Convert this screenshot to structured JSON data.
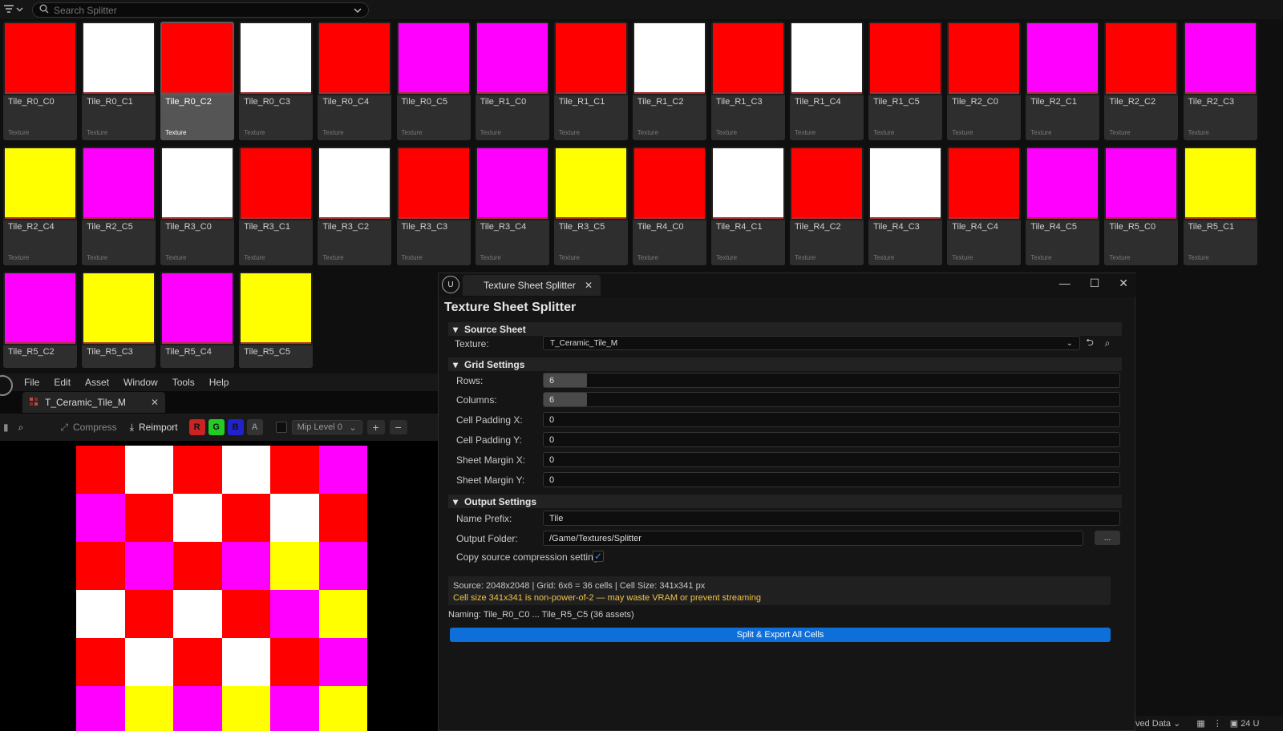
{
  "search": {
    "placeholder": "Search Splitter"
  },
  "colors": {
    "red": "#ff0000",
    "white": "#ffffff",
    "magenta": "#ff00ff",
    "yellow": "#ffff00",
    "accent": "#0e6fd8",
    "warning": "#f0c34a"
  },
  "tiles": [
    {
      "name": "Tile_R0_C0",
      "type": "Texture",
      "color": "red"
    },
    {
      "name": "Tile_R0_C1",
      "type": "Texture",
      "color": "white"
    },
    {
      "name": "Tile_R0_C2",
      "type": "Texture",
      "color": "red",
      "selected": true
    },
    {
      "name": "Tile_R0_C3",
      "type": "Texture",
      "color": "white"
    },
    {
      "name": "Tile_R0_C4",
      "type": "Texture",
      "color": "red"
    },
    {
      "name": "Tile_R0_C5",
      "type": "Texture",
      "color": "magenta"
    },
    {
      "name": "Tile_R1_C0",
      "type": "Texture",
      "color": "magenta"
    },
    {
      "name": "Tile_R1_C1",
      "type": "Texture",
      "color": "red"
    },
    {
      "name": "Tile_R1_C2",
      "type": "Texture",
      "color": "white"
    },
    {
      "name": "Tile_R1_C3",
      "type": "Texture",
      "color": "red"
    },
    {
      "name": "Tile_R1_C4",
      "type": "Texture",
      "color": "white"
    },
    {
      "name": "Tile_R1_C5",
      "type": "Texture",
      "color": "red"
    },
    {
      "name": "Tile_R2_C0",
      "type": "Texture",
      "color": "red"
    },
    {
      "name": "Tile_R2_C1",
      "type": "Texture",
      "color": "magenta"
    },
    {
      "name": "Tile_R2_C2",
      "type": "Texture",
      "color": "red"
    },
    {
      "name": "Tile_R2_C3",
      "type": "Texture",
      "color": "magenta"
    },
    {
      "name": "Tile_R2_C4",
      "type": "Texture",
      "color": "yellow"
    },
    {
      "name": "Tile_R2_C5",
      "type": "Texture",
      "color": "magenta"
    },
    {
      "name": "Tile_R3_C0",
      "type": "Texture",
      "color": "white"
    },
    {
      "name": "Tile_R3_C1",
      "type": "Texture",
      "color": "red"
    },
    {
      "name": "Tile_R3_C2",
      "type": "Texture",
      "color": "white"
    },
    {
      "name": "Tile_R3_C3",
      "type": "Texture",
      "color": "red"
    },
    {
      "name": "Tile_R3_C4",
      "type": "Texture",
      "color": "magenta"
    },
    {
      "name": "Tile_R3_C5",
      "type": "Texture",
      "color": "yellow"
    },
    {
      "name": "Tile_R4_C0",
      "type": "Texture",
      "color": "red"
    },
    {
      "name": "Tile_R4_C1",
      "type": "Texture",
      "color": "white"
    },
    {
      "name": "Tile_R4_C2",
      "type": "Texture",
      "color": "red"
    },
    {
      "name": "Tile_R4_C3",
      "type": "Texture",
      "color": "white"
    },
    {
      "name": "Tile_R4_C4",
      "type": "Texture",
      "color": "red"
    },
    {
      "name": "Tile_R4_C5",
      "type": "Texture",
      "color": "magenta"
    },
    {
      "name": "Tile_R5_C0",
      "type": "Texture",
      "color": "magenta"
    },
    {
      "name": "Tile_R5_C1",
      "type": "Texture",
      "color": "yellow"
    },
    {
      "name": "Tile_R5_C2",
      "type": "Texture",
      "color": "magenta"
    },
    {
      "name": "Tile_R5_C3",
      "type": "Texture",
      "color": "yellow"
    },
    {
      "name": "Tile_R5_C4",
      "type": "Texture",
      "color": "magenta"
    },
    {
      "name": "Tile_R5_C5",
      "type": "Texture",
      "color": "yellow"
    }
  ],
  "editor": {
    "menu": [
      "File",
      "Edit",
      "Asset",
      "Window",
      "Tools",
      "Help"
    ],
    "asset_tab": "T_Ceramic_Tile_M",
    "compress_label": "Compress",
    "reimport_label": "Reimport",
    "channels": [
      "R",
      "G",
      "B",
      "A"
    ],
    "mip_label": "Mip Level 0",
    "sheet_colors": [
      [
        "red",
        "white",
        "red",
        "white",
        "red",
        "magenta"
      ],
      [
        "magenta",
        "red",
        "white",
        "red",
        "white",
        "red"
      ],
      [
        "red",
        "magenta",
        "red",
        "magenta",
        "yellow",
        "magenta"
      ],
      [
        "white",
        "red",
        "white",
        "red",
        "magenta",
        "yellow"
      ],
      [
        "red",
        "white",
        "red",
        "white",
        "red",
        "magenta"
      ],
      [
        "magenta",
        "yellow",
        "magenta",
        "yellow",
        "magenta",
        "yellow"
      ]
    ]
  },
  "dialog": {
    "tab_title": "Texture Sheet Splitter",
    "heading": "Texture Sheet Splitter",
    "source_section": "Source Sheet",
    "texture_label": "Texture:",
    "texture_value": "T_Ceramic_Tile_M",
    "grid_section": "Grid Settings",
    "rows_label": "Rows:",
    "rows_value": "6",
    "columns_label": "Columns:",
    "columns_value": "6",
    "cell_padding_x_label": "Cell Padding X:",
    "cell_padding_x_value": "0",
    "cell_padding_y_label": "Cell Padding Y:",
    "cell_padding_y_value": "0",
    "sheet_margin_x_label": "Sheet Margin X:",
    "sheet_margin_x_value": "0",
    "sheet_margin_y_label": "Sheet Margin Y:",
    "sheet_margin_y_value": "0",
    "output_section": "Output Settings",
    "name_prefix_label": "Name Prefix:",
    "name_prefix_value": "Tile",
    "output_folder_label": "Output Folder:",
    "output_folder_value": "/Game/Textures/Splitter",
    "browse_label": "...",
    "copy_compression_label": "Copy source compression settings",
    "copy_compression_checked": true,
    "info_line1": "Source: 2048x2048 | Grid: 6x6 = 36 cells | Cell Size: 341x341 px",
    "info_line2": "Cell size 341x341 is non-power-of-2 — may waste VRAM or prevent streaming",
    "naming": "Naming: Tile_R0_C0 ... Tile_R5_C5 (36 assets)",
    "split_button": "Split & Export All Cells"
  },
  "statusbar": {
    "saved_data": "ved Data",
    "count": "24 U"
  }
}
